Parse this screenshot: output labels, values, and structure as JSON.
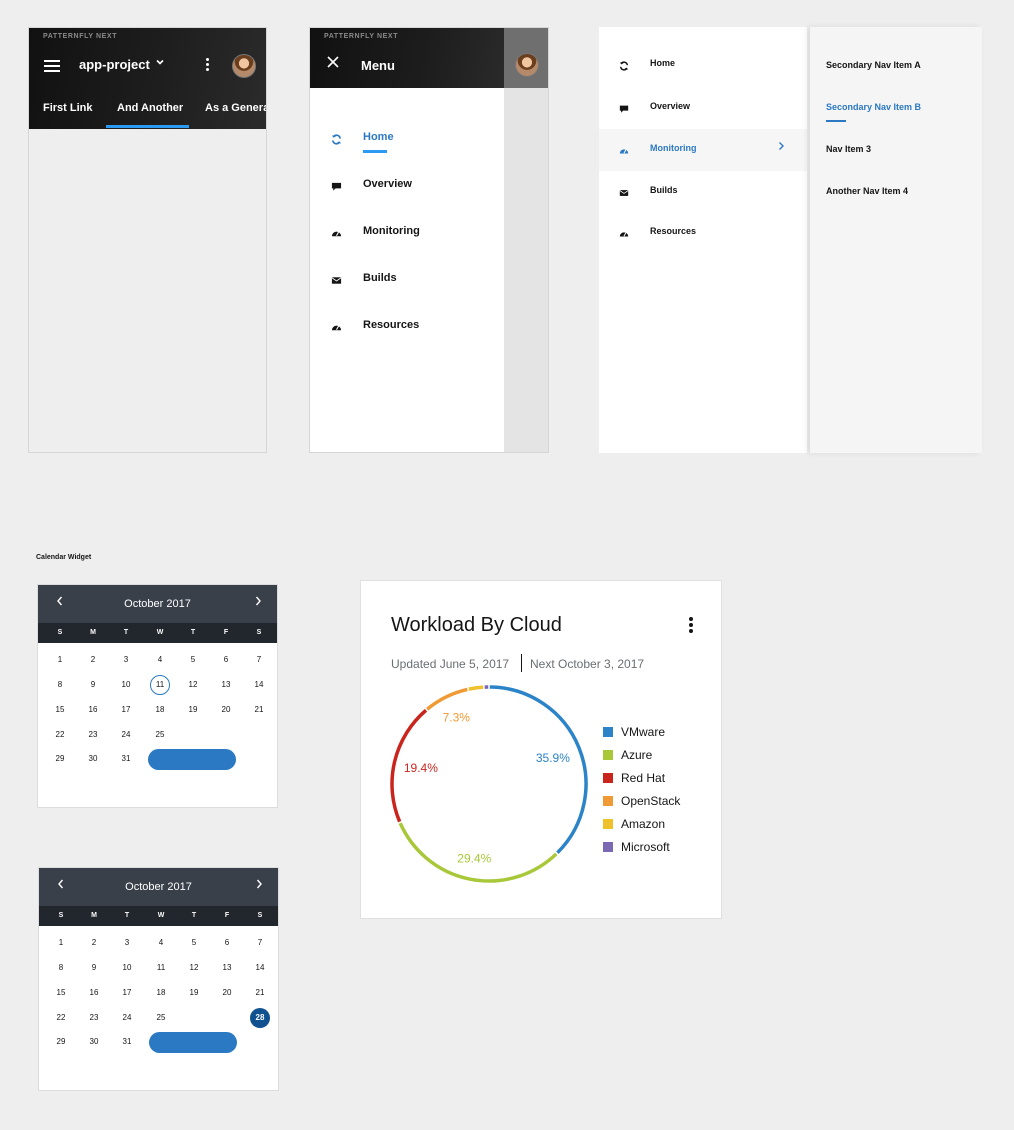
{
  "frame1": {
    "brand": "PATTERNFLY NEXT",
    "project": "app-project",
    "tabs": [
      "First Link",
      "And Another",
      "As a Genera"
    ]
  },
  "frame2": {
    "brand": "PATTERNFLY NEXT",
    "menu_title": "Menu",
    "items": [
      "Home",
      "Overview",
      "Monitoring",
      "Builds",
      "Resources"
    ]
  },
  "frame3": {
    "primary": [
      "Home",
      "Overview",
      "Monitoring",
      "Builds",
      "Resources"
    ],
    "secondary": [
      "Secondary Nav Item A",
      "Secondary Nav Item B",
      "Nav Item 3",
      "Another Nav Item 4"
    ]
  },
  "calendar_caption": "Calendar Widget",
  "calendars": [
    {
      "title": "October 2017",
      "weekdays": [
        "S",
        "M",
        "T",
        "W",
        "T",
        "F",
        "S"
      ]
    },
    {
      "title": "October 2017",
      "weekdays": [
        "S",
        "M",
        "T",
        "W",
        "T",
        "F",
        "S"
      ]
    }
  ],
  "workload": {
    "title": "Workload By Cloud",
    "updated": "Updated June 5, 2017",
    "next": "Next October 3, 2017",
    "labels": [
      "35.9%",
      "29.4%",
      "19.4%",
      "7.3%"
    ]
  },
  "colors": {
    "accent": "#2b79c2",
    "vmware": "#2b83c8",
    "azure": "#a8c83a",
    "redhat": "#c9251d",
    "openstack": "#ef9a34",
    "amazon": "#f0c12c",
    "microsoft": "#7b69b4"
  },
  "chart_data": {
    "type": "pie",
    "categories": [
      "VMware",
      "Azure",
      "Red Hat",
      "OpenStack",
      "Amazon",
      "Microsoft"
    ],
    "values": [
      35.9,
      29.4,
      19.4,
      7.3,
      2.5,
      0.8
    ],
    "data_labels": [
      "35.9%",
      "29.4%",
      "19.4%",
      "7.3%"
    ],
    "title": "Workload By Cloud",
    "legend": "right"
  }
}
